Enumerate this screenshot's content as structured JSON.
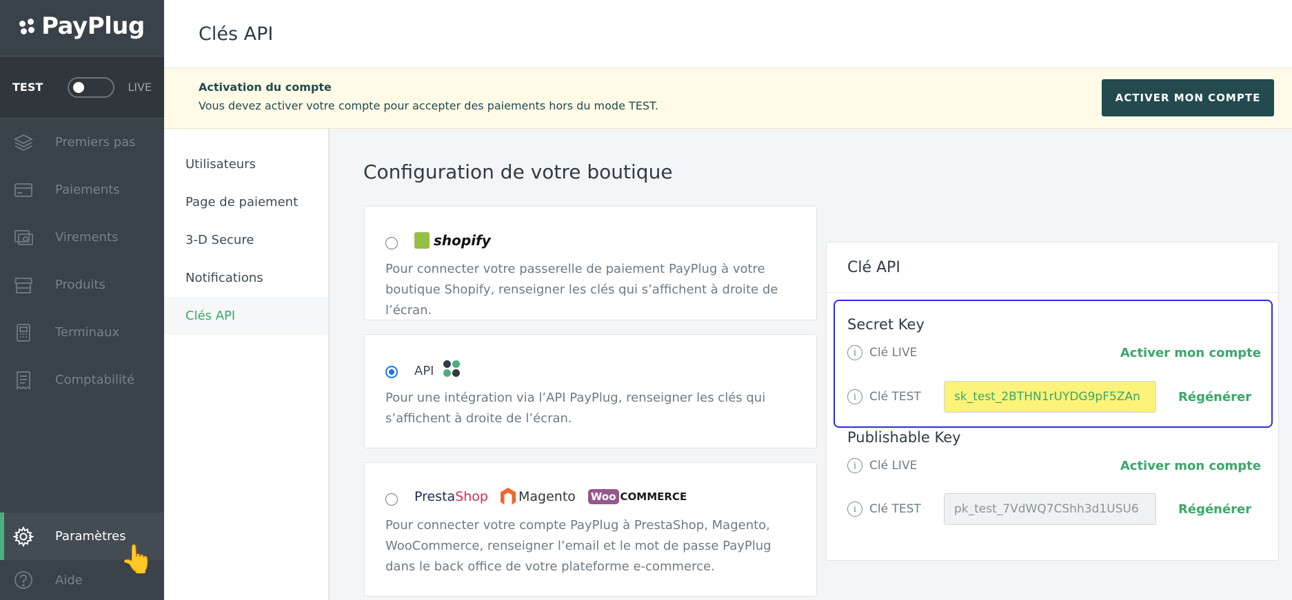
{
  "brand": {
    "name": "PayPlug"
  },
  "mode": {
    "test_label": "TEST",
    "live_label": "LIVE",
    "live_enabled": false
  },
  "sidebar": {
    "items": [
      {
        "label": "Premiers pas",
        "icon": "layers-icon"
      },
      {
        "label": "Paiements",
        "icon": "credit-card-icon"
      },
      {
        "label": "Virements",
        "icon": "transfer-icon"
      },
      {
        "label": "Produits",
        "icon": "store-icon"
      },
      {
        "label": "Terminaux",
        "icon": "terminal-icon"
      },
      {
        "label": "Comptabilité",
        "icon": "receipt-icon"
      }
    ],
    "bottom": [
      {
        "label": "Paramètres",
        "icon": "gear-icon",
        "active": true
      },
      {
        "label": "Aide",
        "icon": "help-icon"
      }
    ]
  },
  "header": {
    "title": "Clés API"
  },
  "banner": {
    "title": "Activation du compte",
    "body": "Vous devez activer votre compte pour accepter des paiements hors du mode TEST.",
    "button": "ACTIVER MON COMPTE"
  },
  "subnav": {
    "items": [
      {
        "label": "Utilisateurs"
      },
      {
        "label": "Page de paiement"
      },
      {
        "label": "3-D Secure"
      },
      {
        "label": "Notifications"
      },
      {
        "label": "Clés API",
        "active": true
      }
    ]
  },
  "main": {
    "title": "Configuration de votre boutique",
    "options": [
      {
        "logo": "shopify",
        "selected": false,
        "desc": "Pour connecter votre passerelle de paiement PayPlug à votre boutique Shopify, renseigner les clés qui s’affichent à droite de l’écran."
      },
      {
        "label": "API",
        "selected": true,
        "desc": "Pour une intégration via l’API PayPlug, renseigner les clés qui s’affichent à droite de l’écran."
      },
      {
        "logos": [
          "PrestaShop",
          "Magento",
          "WooCommerce"
        ],
        "selected": false,
        "desc": "Pour connecter votre compte PayPlug à PrestaShop, Magento, WooCommerce, renseigner l’email et le mot de passe PayPlug dans le back office de votre plateforme e-commerce."
      }
    ]
  },
  "api_panel": {
    "title": "Clé API",
    "secret": {
      "title": "Secret Key",
      "live_label": "Clé LIVE",
      "live_action": "Activer mon compte",
      "test_label": "Clé TEST",
      "test_value": "sk_test_2BTHN1rUYDG9pF5ZAn",
      "test_action": "Régénérer"
    },
    "publishable": {
      "title": "Publishable Key",
      "live_label": "Clé LIVE",
      "live_action": "Activer mon compte",
      "test_label": "Clé TEST",
      "test_value": "pk_test_7VdWQ7CShh3d1USU6",
      "test_action": "Régénérer"
    }
  },
  "logo_text": {
    "shopify": "shopify",
    "presta_a": "Presta",
    "presta_b": "Shop",
    "magento": "Magento",
    "woo_a": "Woo",
    "woo_b": "COMMERCE"
  },
  "colors": {
    "sidebar": "#394249",
    "accent": "#3aa86a",
    "banner_bg": "#fffbe7",
    "button": "#234a4e",
    "highlight": "#2a2ae8",
    "key_highlight": "#fbf37a"
  }
}
